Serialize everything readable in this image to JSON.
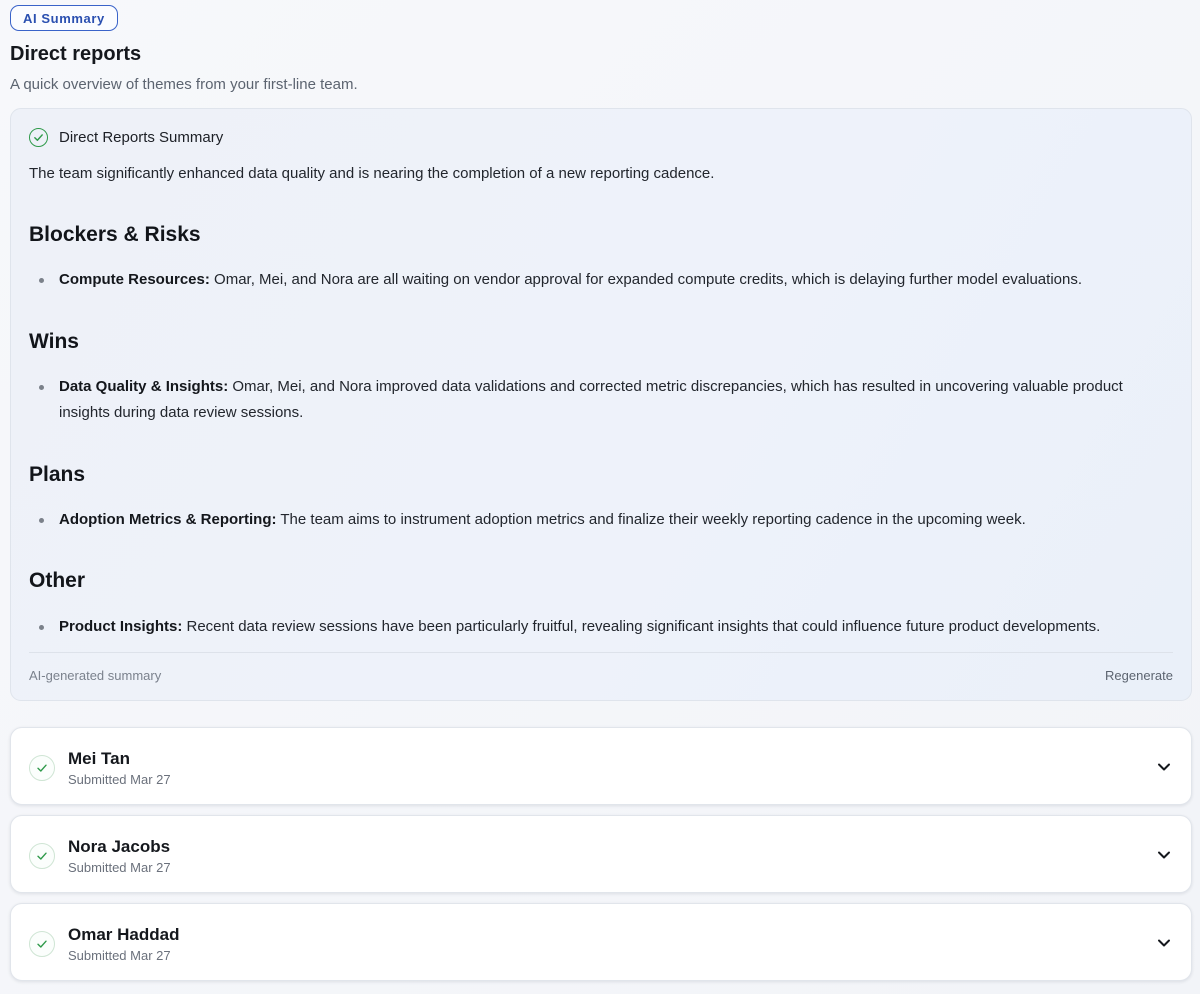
{
  "badge": "AI Summary",
  "header": {
    "title": "Direct reports",
    "subtitle": "A quick overview of themes from your first-line team."
  },
  "summary": {
    "title": "Direct Reports Summary",
    "intro": "The team significantly enhanced data quality and is nearing the completion of a new reporting cadence.",
    "sections": [
      {
        "heading": "Blockers & Risks",
        "label": "Compute Resources:",
        "text": " Omar, Mei, and Nora are all waiting on vendor approval for expanded compute credits, which is delaying further model evaluations."
      },
      {
        "heading": "Wins",
        "label": "Data Quality & Insights:",
        "text": " Omar, Mei, and Nora improved data validations and corrected metric discrepancies, which has resulted in uncovering valuable product insights during data review sessions."
      },
      {
        "heading": "Plans",
        "label": "Adoption Metrics & Reporting:",
        "text": " The team aims to instrument adoption metrics and finalize their weekly reporting cadence in the upcoming week."
      },
      {
        "heading": "Other",
        "label": "Product Insights:",
        "text": " Recent data review sessions have been particularly fruitful, revealing significant insights that could influence future product developments."
      }
    ],
    "footer_left": "AI-generated summary",
    "footer_right": "Regenerate"
  },
  "reports": [
    {
      "name": "Mei Tan",
      "status": "Submitted Mar 27"
    },
    {
      "name": "Nora Jacobs",
      "status": "Submitted Mar 27"
    },
    {
      "name": "Omar Haddad",
      "status": "Submitted Mar 27"
    }
  ],
  "colors": {
    "accent": "#3a63c9",
    "success": "#2f9a4a"
  }
}
